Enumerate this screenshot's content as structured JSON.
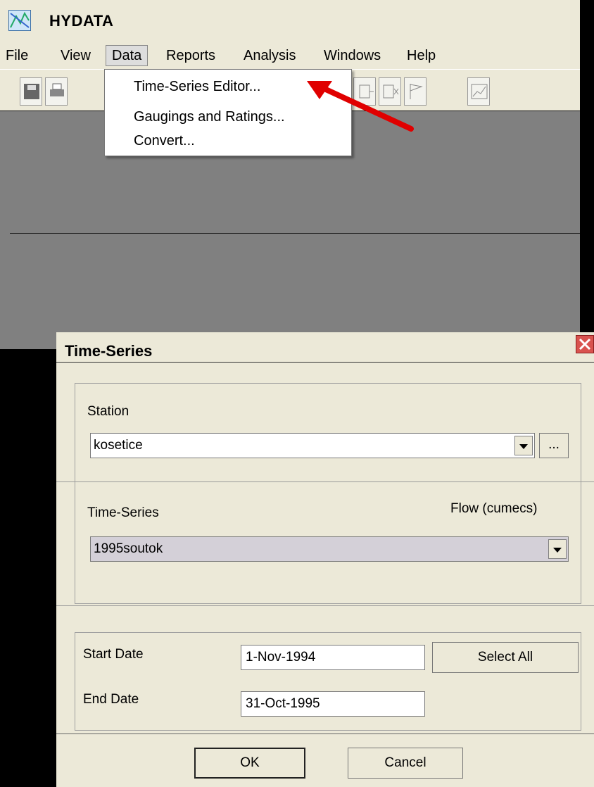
{
  "app": {
    "title": "HYDATA",
    "icon": "chart-icon"
  },
  "menubar": {
    "items": [
      "File",
      "View",
      "Data",
      "Reports",
      "Analysis",
      "Windows",
      "Help"
    ],
    "active": "Data"
  },
  "data_menu": {
    "items": [
      "Time-Series Editor...",
      "Gaugings and Ratings...",
      "Convert..."
    ]
  },
  "toolbar": {
    "icons": [
      "save-icon",
      "print-icon",
      "tool-icon-1",
      "tool-icon-2",
      "flag-icon",
      "chart-icon"
    ]
  },
  "annotation": {
    "arrow_color": "#e00000"
  },
  "dialog": {
    "title": "Time-Series",
    "station_label": "Station",
    "station_value": "kosetice",
    "browse_label": "...",
    "timeseries_label": "Time-Series",
    "units_label": "Flow (cumecs)",
    "timeseries_value": "1995soutok",
    "start_date_label": "Start Date",
    "start_date_value": "1-Nov-1994",
    "end_date_label": "End Date",
    "end_date_value": "31-Oct-1995",
    "select_all_label": "Select All",
    "ok_label": "OK",
    "cancel_label": "Cancel"
  },
  "colors": {
    "workspace": "#808080",
    "dialog_bg": "#ece9d8",
    "close_button": "#d9534f",
    "combo_selected": "#d4d0d8"
  }
}
